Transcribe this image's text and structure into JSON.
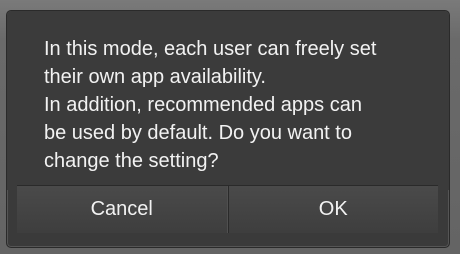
{
  "dialog": {
    "message_lines": [
      "In this mode, each user can freely set",
      "their own app availability.",
      "In addition, recommended apps can",
      "be used by default. Do you want to",
      "change the setting?"
    ],
    "cancel_label": "Cancel",
    "ok_label": "OK"
  }
}
